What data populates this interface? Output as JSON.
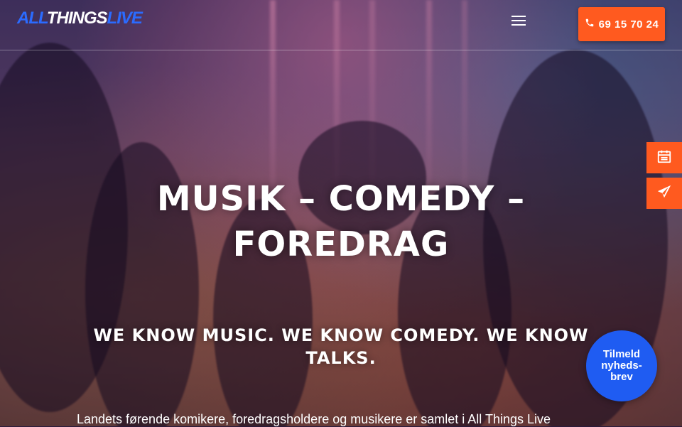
{
  "header": {
    "logo": {
      "part1": "ALL",
      "part2": "THINGS",
      "part3": "LIVE"
    },
    "menu_icon": "hamburger-icon",
    "phone": {
      "icon": "phone-icon",
      "label": "69 15 70 24"
    }
  },
  "side_actions": [
    {
      "icon": "calendar-icon"
    },
    {
      "icon": "paper-plane-icon"
    }
  ],
  "hero": {
    "title_line1": "MUSIK – COMEDY –",
    "title_line2": "FOREDRAG",
    "subtitle_line1": "WE KNOW MUSIC. WE KNOW COMEDY. WE KNOW",
    "subtitle_line2": "TALKS.",
    "intro": "Landets førende komikere, foredragsholdere og musikere er samlet i All Things Live"
  },
  "newsletter": {
    "line1": "Tilmeld",
    "line2": "nyheds-",
    "line3": "brev"
  },
  "colors": {
    "accent_orange": "#ff5a1f",
    "brand_blue": "#2b6bff",
    "newsletter_blue": "#1f5cf2"
  }
}
